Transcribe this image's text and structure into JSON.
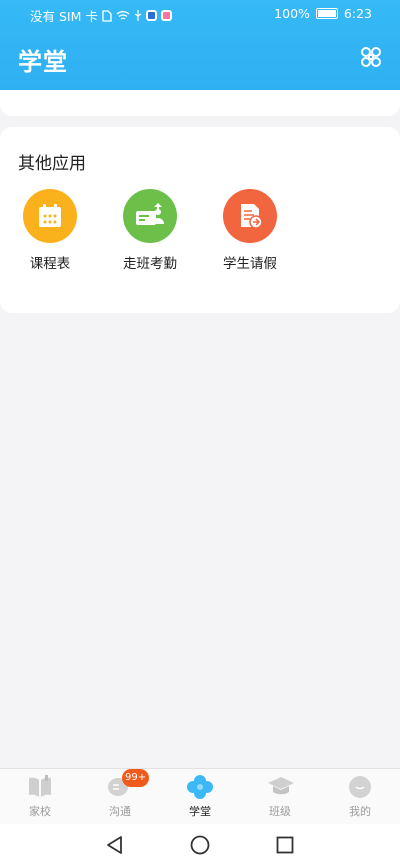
{
  "status_bar": {
    "carrier": "没有 SIM 卡",
    "battery": "100%",
    "time": "6:23"
  },
  "header": {
    "title": "学堂",
    "bg_color": "#2fb0f2"
  },
  "other_apps": {
    "title": "其他应用",
    "items": [
      {
        "label": "课程表",
        "icon": "calendar-icon",
        "color": "#fbb11c"
      },
      {
        "label": "走班考勤",
        "icon": "id-card-upload-icon",
        "color": "#6cc04a"
      },
      {
        "label": "学生请假",
        "icon": "leave-note-icon",
        "color": "#f1653f"
      }
    ]
  },
  "tabbar": {
    "items": [
      {
        "label": "家校",
        "icon": "book-icon",
        "active": false
      },
      {
        "label": "沟通",
        "icon": "chat-icon",
        "active": false,
        "badge": "99+"
      },
      {
        "label": "学堂",
        "icon": "clover-icon",
        "active": true
      },
      {
        "label": "班级",
        "icon": "graduation-cap-icon",
        "active": false
      },
      {
        "label": "我的",
        "icon": "face-icon",
        "active": false
      }
    ]
  }
}
